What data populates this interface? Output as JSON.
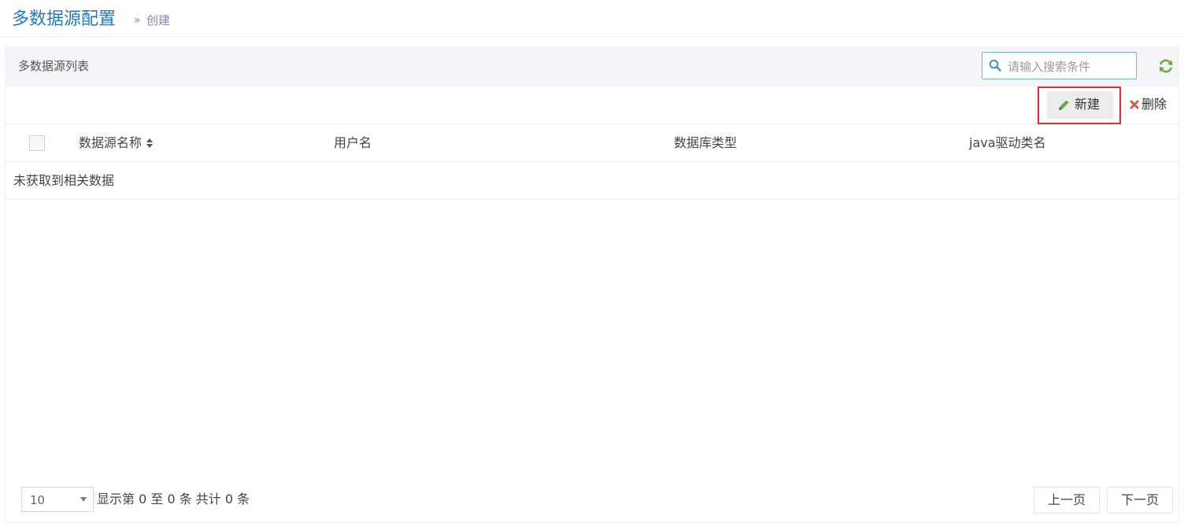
{
  "header": {
    "title": "多数据源配置",
    "breadcrumb_separator": "»",
    "breadcrumb_current": "创建"
  },
  "panel": {
    "title": "多数据源列表",
    "search": {
      "placeholder": "请输入搜索条件",
      "value": ""
    },
    "icons": {
      "search": "search-icon",
      "refresh": "refresh-icon"
    }
  },
  "toolbar": {
    "new_label": "新建",
    "delete_label": "删除"
  },
  "table": {
    "columns": [
      {
        "label": "数据源名称",
        "sortable": true
      },
      {
        "label": "用户名"
      },
      {
        "label": "数据库类型"
      },
      {
        "label": "java驱动类名"
      }
    ],
    "empty_message": "未获取到相关数据"
  },
  "footer": {
    "page_size": "10",
    "info": "显示第 0 至 0 条 共计 0 条",
    "prev_label": "上一页",
    "next_label": "下一页"
  },
  "colors": {
    "title_blue": "#2679b5",
    "search_border": "#6fb3e0",
    "refresh_green": "#69aa46",
    "pencil_green": "#69aa46",
    "delete_red": "#d15b47",
    "highlight_red": "#e02c2c"
  }
}
